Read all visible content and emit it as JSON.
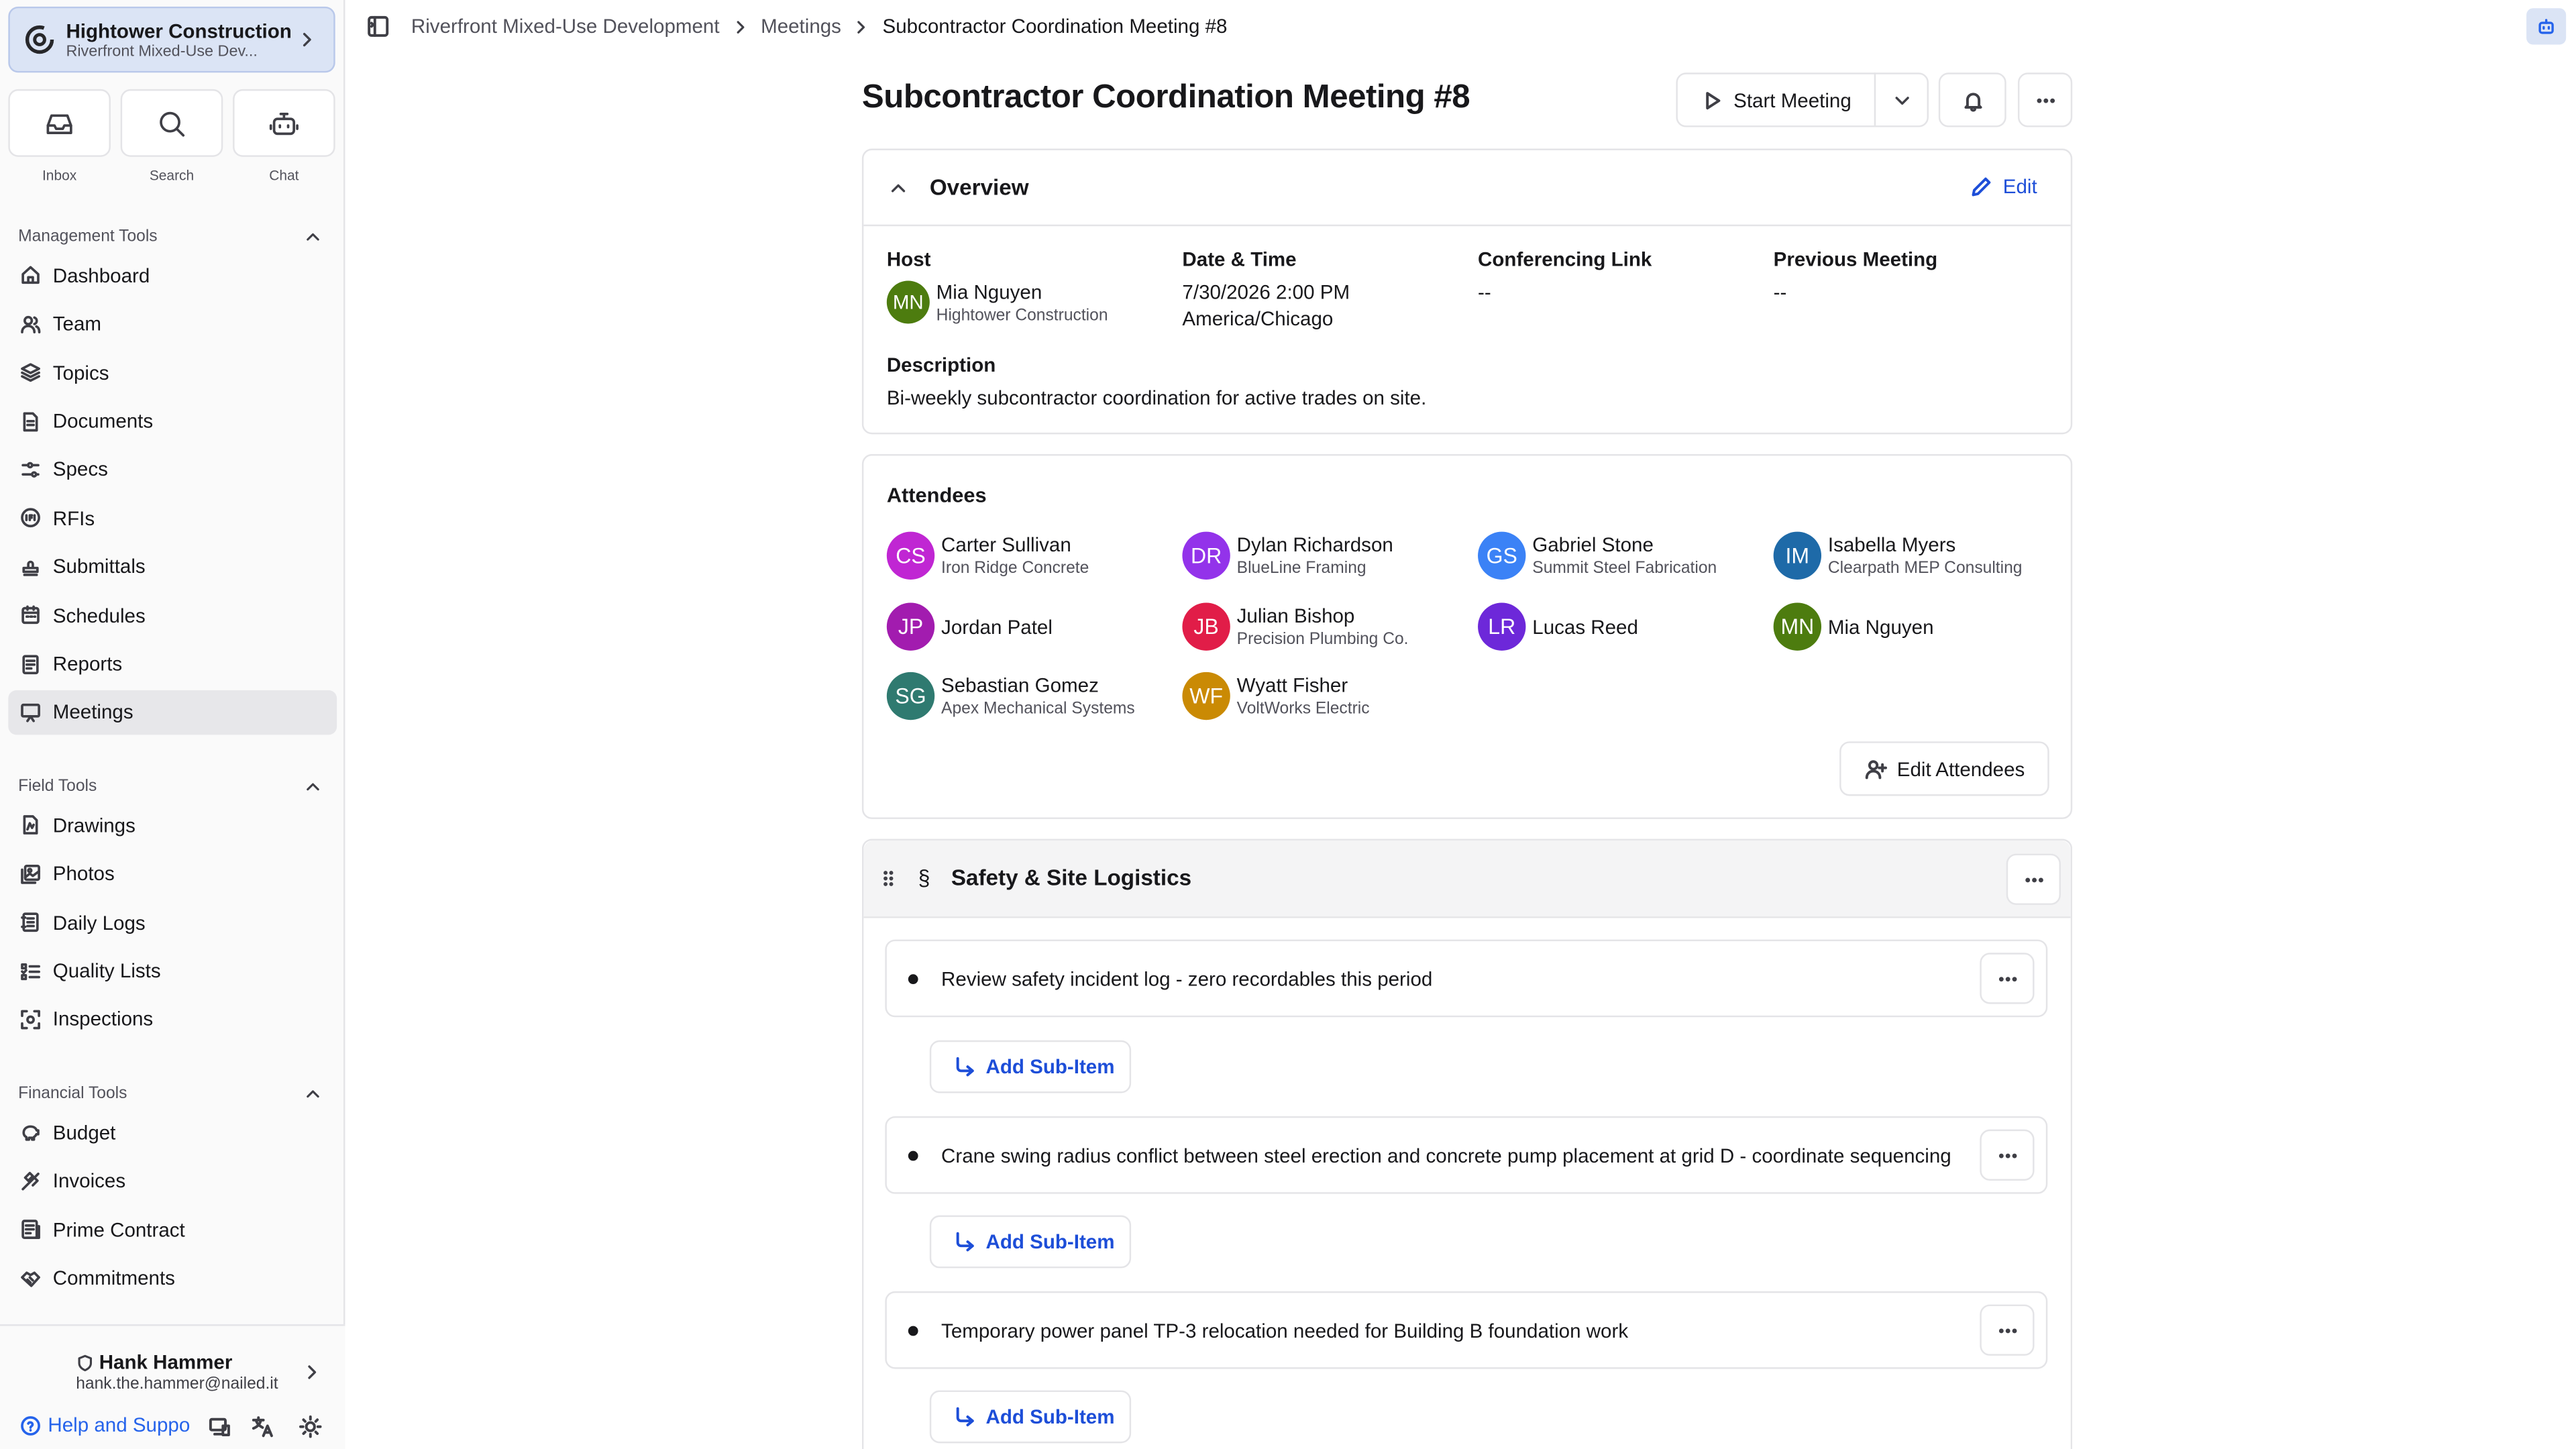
{
  "org": {
    "name": "Hightower Construction",
    "project": "Riverfront Mixed-Use Dev..."
  },
  "quick": [
    {
      "label": "Inbox",
      "icon": "inbox-icon"
    },
    {
      "label": "Search",
      "icon": "search-icon"
    },
    {
      "label": "Chat",
      "icon": "bot-icon"
    }
  ],
  "sections": {
    "management": {
      "title": "Management Tools",
      "items": [
        {
          "label": "Dashboard",
          "icon": "home-icon"
        },
        {
          "label": "Team",
          "icon": "users-icon"
        },
        {
          "label": "Topics",
          "icon": "layers-icon"
        },
        {
          "label": "Documents",
          "icon": "file-icon"
        },
        {
          "label": "Specs",
          "icon": "sliders-icon"
        },
        {
          "label": "RFIs",
          "icon": "rfi-icon"
        },
        {
          "label": "Submittals",
          "icon": "stamp-icon"
        },
        {
          "label": "Schedules",
          "icon": "calendar-icon"
        },
        {
          "label": "Reports",
          "icon": "report-icon"
        },
        {
          "label": "Meetings",
          "icon": "presentation-icon"
        }
      ]
    },
    "field": {
      "title": "Field Tools",
      "items": [
        {
          "label": "Drawings",
          "icon": "drawing-icon"
        },
        {
          "label": "Photos",
          "icon": "photos-icon"
        },
        {
          "label": "Daily Logs",
          "icon": "notebook-icon"
        },
        {
          "label": "Quality Lists",
          "icon": "checklist-icon"
        },
        {
          "label": "Inspections",
          "icon": "scan-icon"
        }
      ]
    },
    "financial": {
      "title": "Financial Tools",
      "items": [
        {
          "label": "Budget",
          "icon": "piggy-icon"
        },
        {
          "label": "Invoices",
          "icon": "invoice-icon"
        },
        {
          "label": "Prime Contract",
          "icon": "contract-icon"
        },
        {
          "label": "Commitments",
          "icon": "handshake-icon"
        }
      ]
    }
  },
  "user": {
    "name": "Hank Hammer",
    "email": "hank.the.hammer@nailed.it",
    "help": "Help and Suppo"
  },
  "breadcrumb": {
    "project": "Riverfront Mixed-Use Development",
    "section": "Meetings",
    "current": "Subcontractor Coordination Meeting #8"
  },
  "meeting": {
    "title": "Subcontractor Coordination Meeting #8",
    "start_label": "Start Meeting"
  },
  "overview": {
    "heading": "Overview",
    "edit_label": "Edit",
    "host_label": "Host",
    "host": {
      "initials": "MN",
      "name": "Mia Nguyen",
      "company": "Hightower Construction"
    },
    "date_label": "Date & Time",
    "date_value": "7/30/2026 2:00 PM",
    "timezone": "America/Chicago",
    "conf_label": "Conferencing Link",
    "conf_value": "--",
    "prev_label": "Previous Meeting",
    "prev_value": "--",
    "desc_label": "Description",
    "desc_value": "Bi-weekly subcontractor coordination for active trades on site."
  },
  "attendees": {
    "heading": "Attendees",
    "edit_label": "Edit Attendees",
    "people": [
      {
        "initials": "CS",
        "name": "Carter Sullivan",
        "company": "Iron Ridge Concrete",
        "color": "#c026d3"
      },
      {
        "initials": "DR",
        "name": "Dylan Richardson",
        "company": "BlueLine Framing",
        "color": "#9333ea"
      },
      {
        "initials": "GS",
        "name": "Gabriel Stone",
        "company": "Summit Steel Fabrication",
        "color": "#3b82f6"
      },
      {
        "initials": "IM",
        "name": "Isabella Myers",
        "company": "Clearpath MEP Consulting",
        "color": "#1e6aa8"
      },
      {
        "initials": "JP",
        "name": "Jordan Patel",
        "company": "",
        "color": "#a21caf"
      },
      {
        "initials": "JB",
        "name": "Julian Bishop",
        "company": "Precision Plumbing Co.",
        "color": "#e11d48"
      },
      {
        "initials": "LR",
        "name": "Lucas Reed",
        "company": "",
        "color": "#6d28d9"
      },
      {
        "initials": "MN",
        "name": "Mia Nguyen",
        "company": "",
        "color": "#4d7c0f"
      },
      {
        "initials": "SG",
        "name": "Sebastian Gomez",
        "company": "Apex Mechanical Systems",
        "color": "#2f7a70"
      },
      {
        "initials": "WF",
        "name": "Wyatt Fisher",
        "company": "VoltWorks Electric",
        "color": "#ca8a04"
      }
    ]
  },
  "agenda": {
    "section_symbol": "§",
    "section_title": "Safety & Site Logistics",
    "items": [
      {
        "text": "Review safety incident log - zero recordables this period"
      },
      {
        "text": "Crane swing radius conflict between steel erection and concrete pump placement at grid D - coordinate sequencing"
      },
      {
        "text": "Temporary power panel TP-3 relocation needed for Building B foundation work"
      }
    ],
    "sub_item_label": "Add Sub-Item"
  }
}
